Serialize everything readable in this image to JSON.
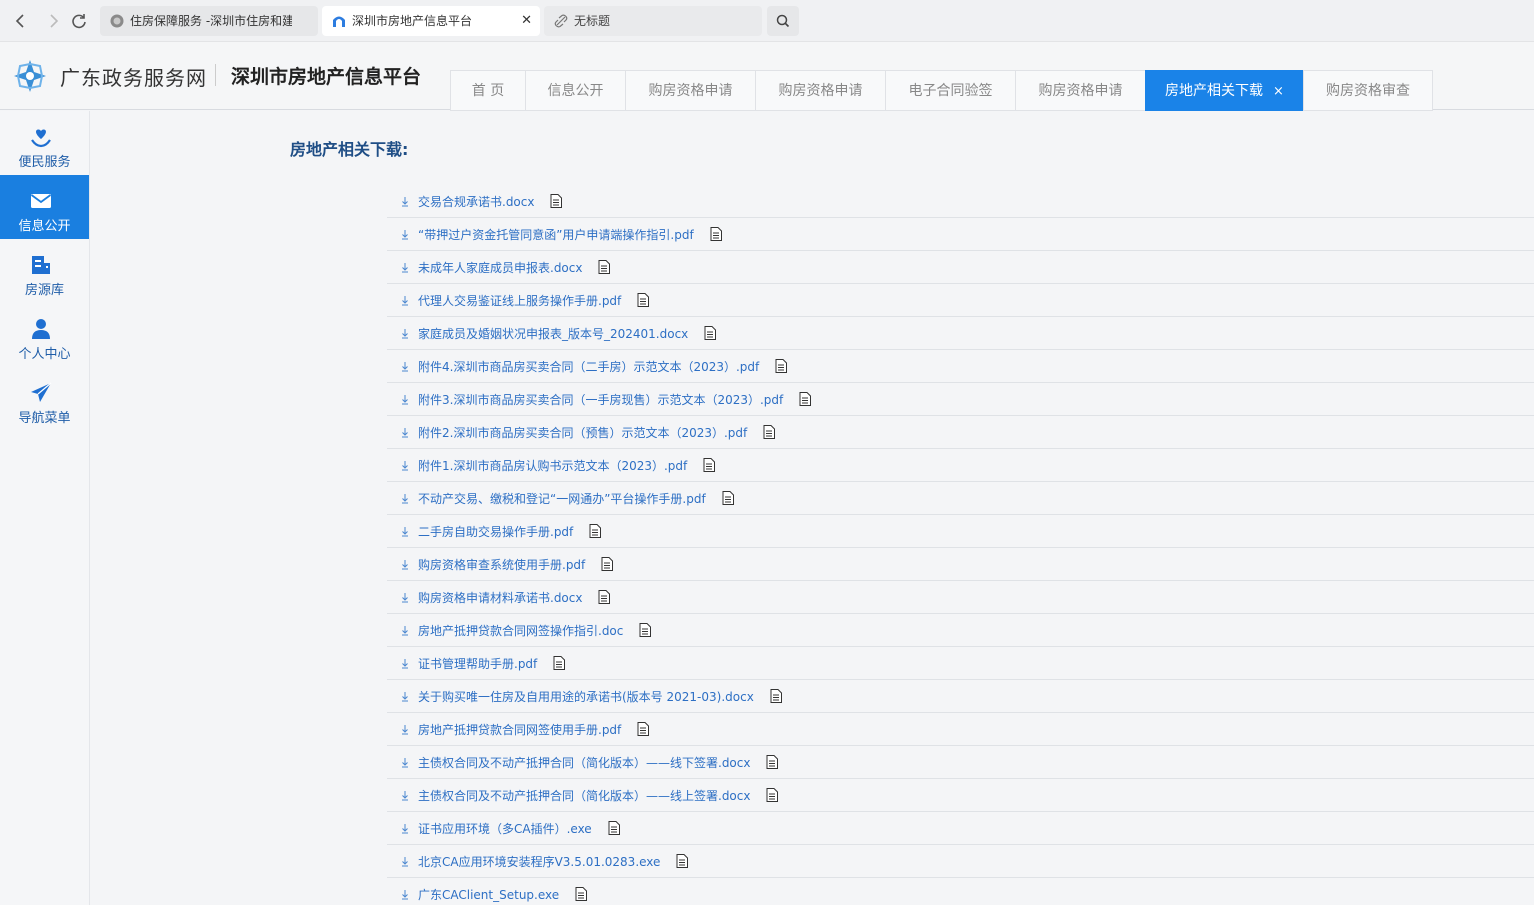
{
  "browser": {
    "tabs": [
      {
        "title": "住房保障服务 -深圳市住房和建设局",
        "icon": "seal-icon"
      },
      {
        "title": "深圳市房地产信息平台",
        "icon": "arch-icon",
        "close": "✕"
      },
      {
        "title": "无标题",
        "icon": "link-icon"
      }
    ]
  },
  "header": {
    "gov_name": "广东政务服务网",
    "platform_name": "深圳市房地产信息平台",
    "nav_tabs": [
      {
        "label": "首 页"
      },
      {
        "label": "信息公开"
      },
      {
        "label": "购房资格申请"
      },
      {
        "label": "购房资格申请"
      },
      {
        "label": "电子合同验签"
      },
      {
        "label": "购房资格申请"
      },
      {
        "label": "房地产相关下载",
        "active": true,
        "close": "×"
      },
      {
        "label": "购房资格审查"
      }
    ]
  },
  "sidebar": {
    "items": [
      {
        "label": "便民服务",
        "icon": "heart-hand-icon"
      },
      {
        "label": "信息公开",
        "icon": "mail-icon",
        "active": true
      },
      {
        "label": "房源库",
        "icon": "building-icon"
      },
      {
        "label": "个人中心",
        "icon": "user-icon"
      },
      {
        "label": "导航菜单",
        "icon": "paper-plane-icon"
      }
    ]
  },
  "main": {
    "section_title": "房地产相关下载:",
    "files": [
      "交易合规承诺书.docx",
      "“带押过户资金托管同意函”用户申请端操作指引.pdf",
      "未成年人家庭成员申报表.docx",
      "代理人交易鉴证线上服务操作手册.pdf",
      "家庭成员及婚姻状况申报表_版本号_202401.docx",
      "附件4.深圳市商品房买卖合同（二手房）示范文本（2023）.pdf",
      "附件3.深圳市商品房买卖合同（一手房现售）示范文本（2023）.pdf",
      "附件2.深圳市商品房买卖合同（预售）示范文本（2023）.pdf",
      "附件1.深圳市商品房认购书示范文本（2023）.pdf",
      "不动产交易、缴税和登记“一网通办”平台操作手册.pdf",
      "二手房自助交易操作手册.pdf",
      "购房资格审查系统使用手册.pdf",
      "购房资格申请材料承诺书.docx",
      "房地产抵押贷款合同网签操作指引.doc",
      "证书管理帮助手册.pdf",
      "关于购买唯一住房及自用用途的承诺书(版本号 2021-03).docx",
      "房地产抵押贷款合同网签使用手册.pdf",
      "主债权合同及不动产抵押合同（简化版本）——线下签署.docx",
      "主债权合同及不动产抵押合同（简化版本）——线上签署.docx",
      "证书应用环境（多CA插件）.exe",
      "北京CA应用环境安装程序V3.5.01.0283.exe",
      "广东CAClient_Setup.exe"
    ]
  }
}
